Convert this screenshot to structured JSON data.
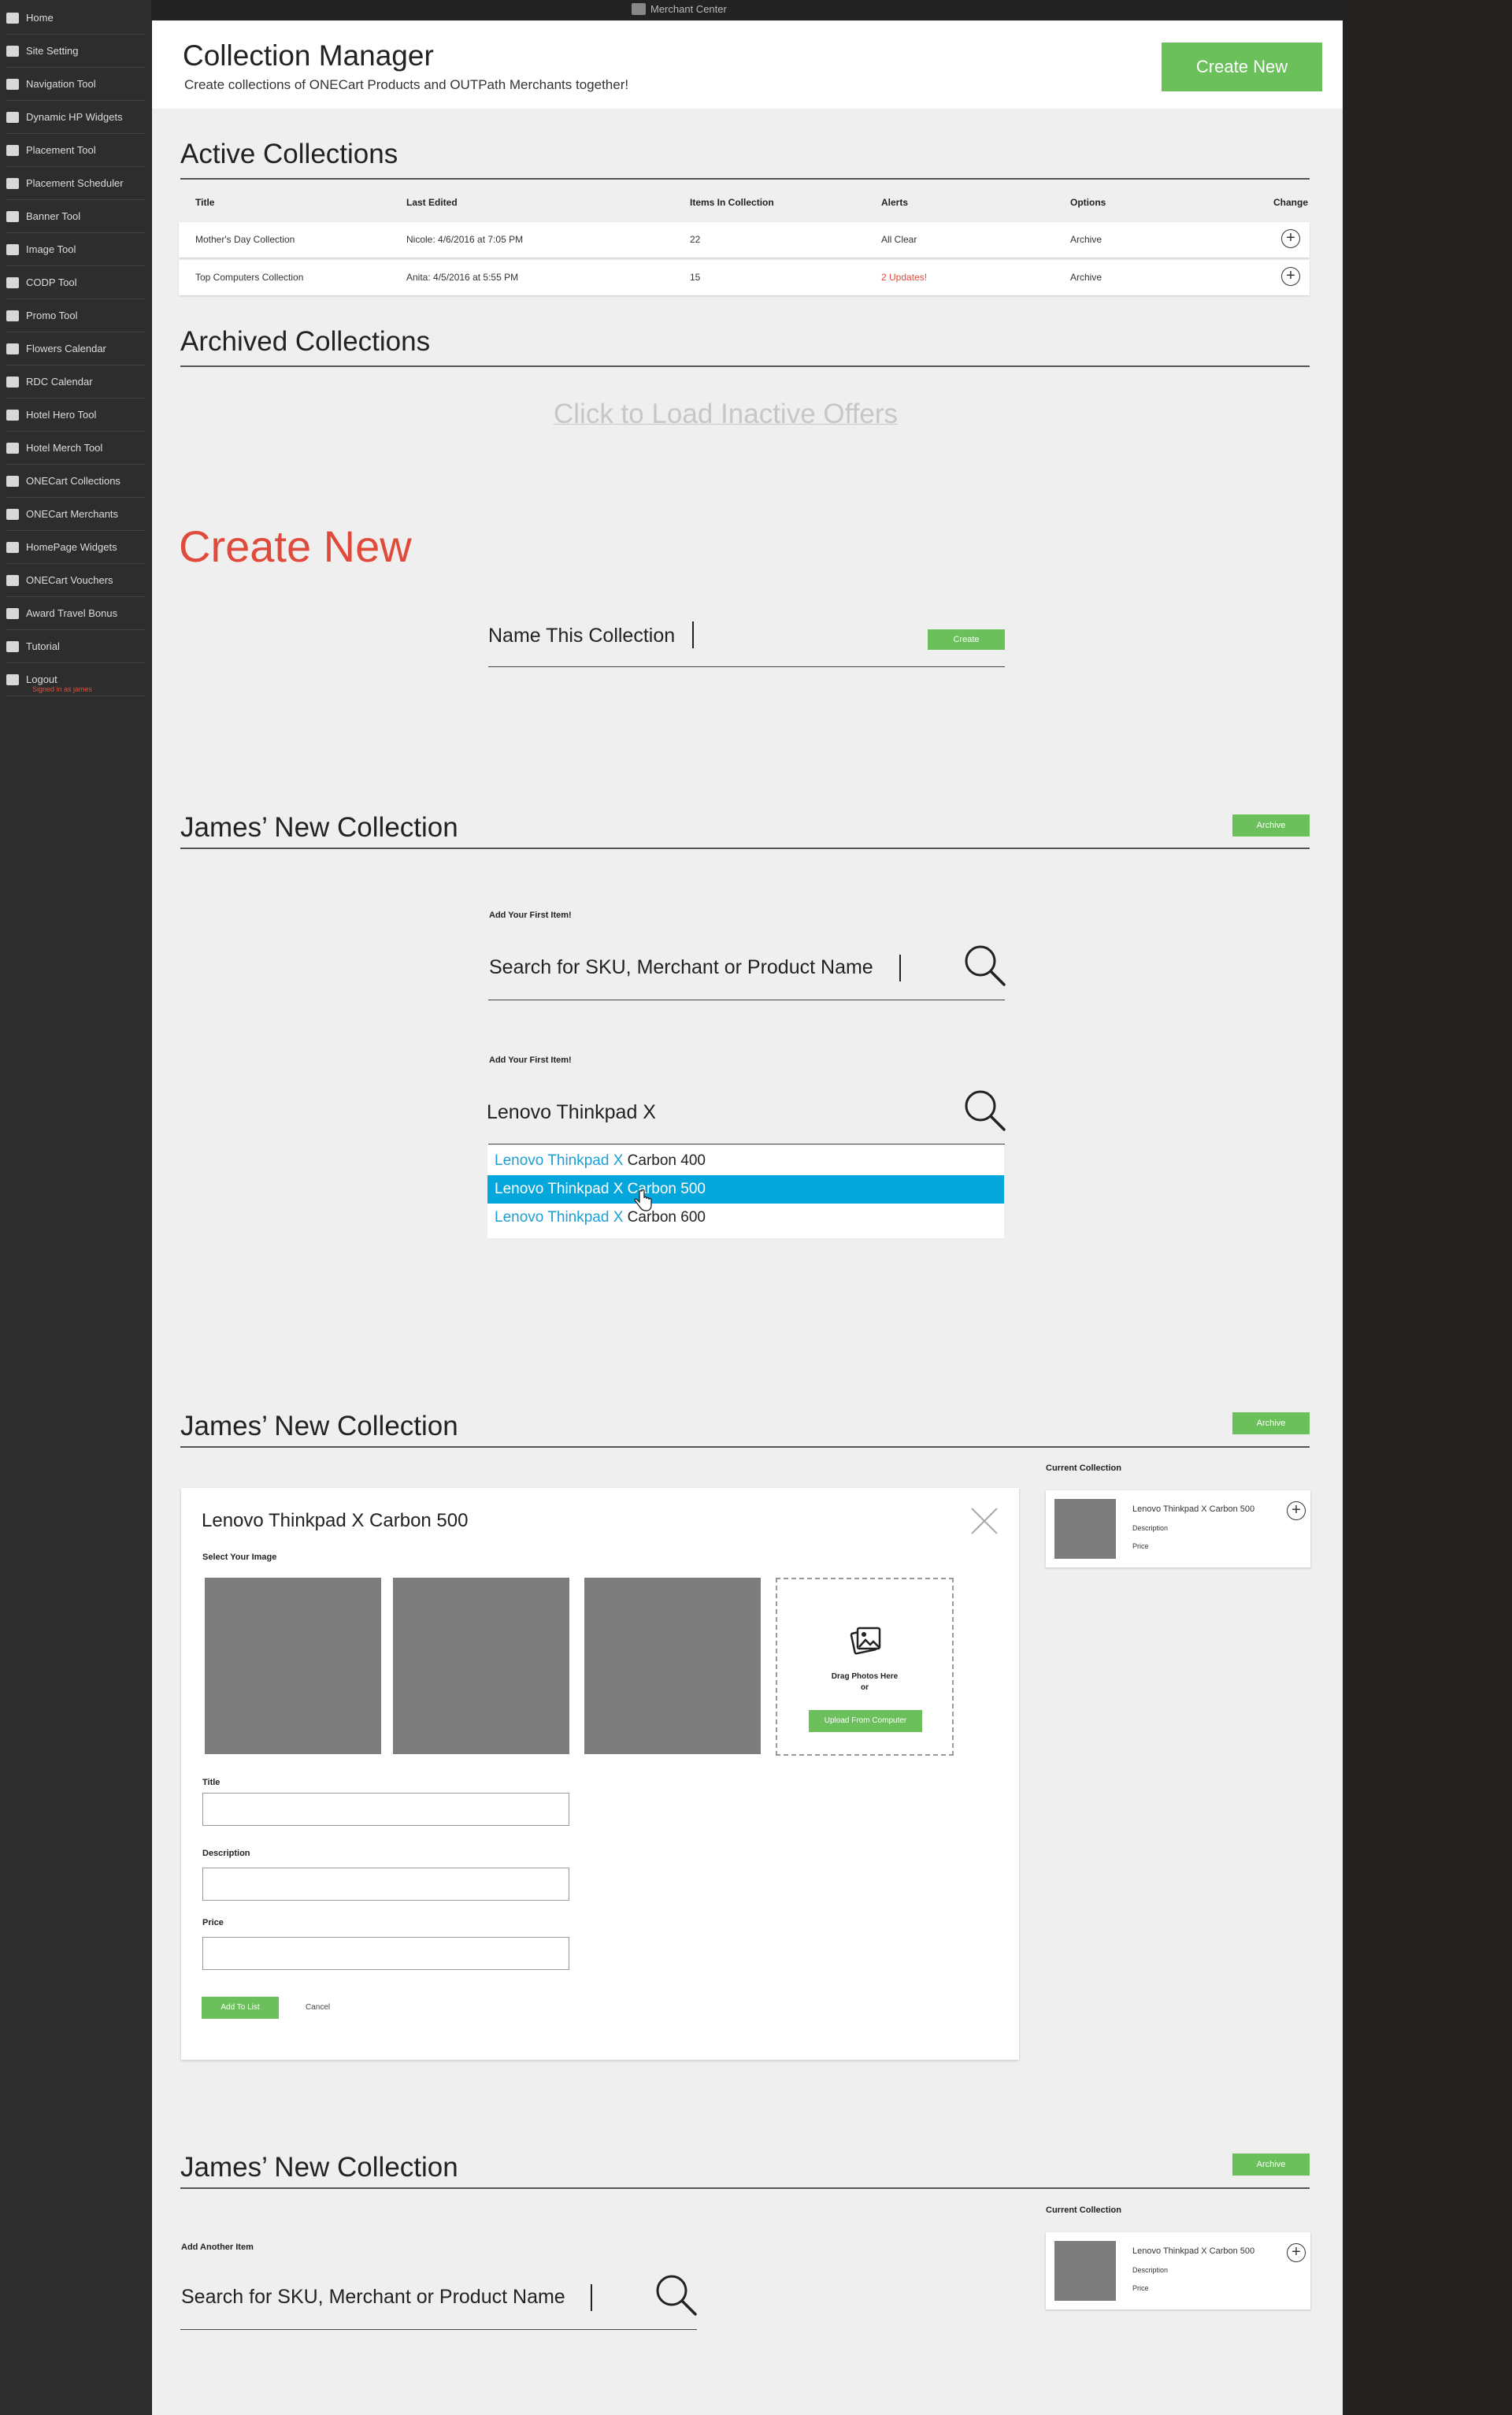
{
  "topbar": {
    "brand": "Merchant Center"
  },
  "sidebar": {
    "items": [
      {
        "label": "Home",
        "icon": "home-icon"
      },
      {
        "label": "Site Setting",
        "icon": "settings-icon"
      },
      {
        "label": "Navigation Tool",
        "icon": "navigation-icon"
      },
      {
        "label": "Dynamic HP Widgets",
        "icon": "widget-icon"
      },
      {
        "label": "Placement Tool",
        "icon": "grid-icon"
      },
      {
        "label": "Placement Scheduler",
        "icon": "grid-icon"
      },
      {
        "label": "Banner Tool",
        "icon": "banner-icon"
      },
      {
        "label": "Image Tool",
        "icon": "image-icon"
      },
      {
        "label": "CODP Tool",
        "icon": "codp-icon"
      },
      {
        "label": "Promo Tool",
        "icon": "promo-icon"
      },
      {
        "label": "Flowers Calendar",
        "icon": "grid-icon"
      },
      {
        "label": "RDC Calendar",
        "icon": "grid-icon"
      },
      {
        "label": "Hotel Hero Tool",
        "icon": "filter-icon"
      },
      {
        "label": "Hotel Merch Tool",
        "icon": "grid-icon"
      },
      {
        "label": "ONECart Collections",
        "icon": "collection-icon"
      },
      {
        "label": "ONECart Merchants",
        "icon": "merchant-icon"
      },
      {
        "label": "HomePage Widgets",
        "icon": "grid-icon"
      },
      {
        "label": "ONECart Vouchers",
        "icon": "voucher-icon"
      },
      {
        "label": "Award Travel Bonus",
        "icon": "tag-icon"
      },
      {
        "label": "Tutorial",
        "icon": "tutorial-icon"
      },
      {
        "label": "Logout",
        "icon": "logout-icon",
        "sub": "Signed in as james"
      }
    ]
  },
  "header": {
    "title": "Collection Manager",
    "subtitle": "Create collections of ONECart Products and OUTPath Merchants together!",
    "create_button": "Create New"
  },
  "active": {
    "title": "Active Collections",
    "columns": [
      "Title",
      "Last Edited",
      "Items In Collection",
      "Alerts",
      "Options",
      "Change"
    ],
    "rows": [
      {
        "title": "Mother's Day Collection",
        "last_edited": "Nicole: 4/6/2016 at 7:05 PM",
        "items": "22",
        "alerts": "All Clear",
        "options": "Archive"
      },
      {
        "title": "Top Computers Collection",
        "last_edited": "Anita: 4/5/2016 at 5:55 PM",
        "items": "15",
        "alerts": "2 Updates!",
        "options": "Archive"
      }
    ]
  },
  "archived": {
    "title": "Archived Collections",
    "load_link": "Click to Load Inactive Offers"
  },
  "create_new": {
    "title": "Create New",
    "name_label": "Name This Collection",
    "create_button": "Create"
  },
  "step1": {
    "title": "James’ New Collection",
    "archive_button": "Archive",
    "add_label": "Add Your First Item!",
    "search_placeholder": "Search for SKU, Merchant or Product Name"
  },
  "step2": {
    "add_label": "Add Your First Item!",
    "search_value": "Lenovo Thinkpad X",
    "suggestions": [
      {
        "match": "Lenovo Thinkpad X",
        "rest": " Carbon 400"
      },
      {
        "match": "Lenovo Thinkpad X",
        "rest": " Carbon 500"
      },
      {
        "match": "Lenovo Thinkpad X",
        "rest": " Carbon 600"
      }
    ]
  },
  "step3": {
    "title": "James’ New Collection",
    "archive_button": "Archive",
    "product_name": "Lenovo Thinkpad X Carbon 500",
    "select_image_label": "Select Your Image",
    "dropzone_text_1": "Drag Photos Here",
    "dropzone_text_2": "or",
    "upload_button": "Upload From Computer",
    "title_label": "Title",
    "description_label": "Description",
    "price_label": "Price",
    "add_button": "Add To List",
    "cancel_link": "Cancel",
    "current": {
      "heading": "Current Collection",
      "item_name": "Lenovo Thinkpad X Carbon 500",
      "item_desc": "Description",
      "item_price": "Price"
    }
  },
  "step4": {
    "title": "James’ New Collection",
    "archive_button": "Archive",
    "add_label": "Add Another Item",
    "search_placeholder": "Search for SKU, Merchant or Product Name",
    "current": {
      "heading": "Current Collection",
      "item_name": "Lenovo Thinkpad X Carbon 500",
      "item_desc": "Description",
      "item_price": "Price"
    }
  },
  "colors": {
    "accent_green": "#6cc05c",
    "alert_red": "#e04a3a",
    "highlight_blue": "#04a6db",
    "match_blue": "#1b9fd7"
  }
}
